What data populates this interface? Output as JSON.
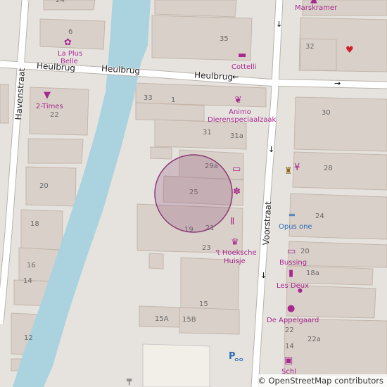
{
  "map": {
    "streets": {
      "heulbrug_1": "Heulbrug",
      "heulbrug_2": "Heulbrug",
      "heulbrug_3": "Heulbrug",
      "havenstraat": "Havenstraat",
      "voorstraat": "Voorstraat"
    },
    "house_numbers": {
      "n24": "24",
      "n6": "6",
      "n35": "35",
      "n32": "32",
      "n33": "33",
      "n1": "1",
      "n30": "30",
      "n22a": "22",
      "n31": "31",
      "n31a": "31a",
      "n29a": "29a",
      "n28": "28",
      "n20a": "20",
      "n25": "25",
      "n24b": "24",
      "n18": "18",
      "n19": "19",
      "n21": "21",
      "n23": "23",
      "n16": "16",
      "n20b": "20",
      "n18a": "18a",
      "n14": "14",
      "n15": "15",
      "n15a": "15A",
      "n15b": "15B",
      "n22b": "22",
      "n22a2": "22a",
      "n12": "12",
      "n14b": "14"
    },
    "pois": {
      "marskramer": "Marskramer",
      "laplus_1": "La Plus",
      "laplus_2": "Belle",
      "cottelli": "Cottelli",
      "twotimes": "2-Times",
      "animo_1": "Animo",
      "animo_2": "Dierenspeciaalzaak",
      "opusone": "Opus one",
      "hoeksche_1": "'t Hoeksche",
      "hoeksche_2": "Huisje",
      "bussing": "Bussing",
      "lesdeux": "Les Deux",
      "appelgaard": "De Appelgaard",
      "partial": "Schl"
    },
    "icons": {
      "arrow_left": "←",
      "arrow_right": "→",
      "arrow_down": "↓",
      "parking_p": "P",
      "bike": "⚲",
      "shirt": "👕",
      "paw": "🐾",
      "shoe": "👞",
      "tooth": "🦷",
      "bed": "🛏",
      "cake": "🎂",
      "knife": "🍴",
      "apple": "🍎",
      "book": "📖"
    },
    "attribution": "© OpenStreetMap contributors",
    "colors": {
      "water": "#aad3df",
      "building": "#d9d0c9",
      "building_stroke": "#c4b6ab",
      "road": "#ffffff",
      "land": "#e6e3df",
      "poi": "#a8288f",
      "marker_fill": "rgba(140,70,120,0.25)",
      "marker_stroke": "#8a3a72"
    }
  }
}
